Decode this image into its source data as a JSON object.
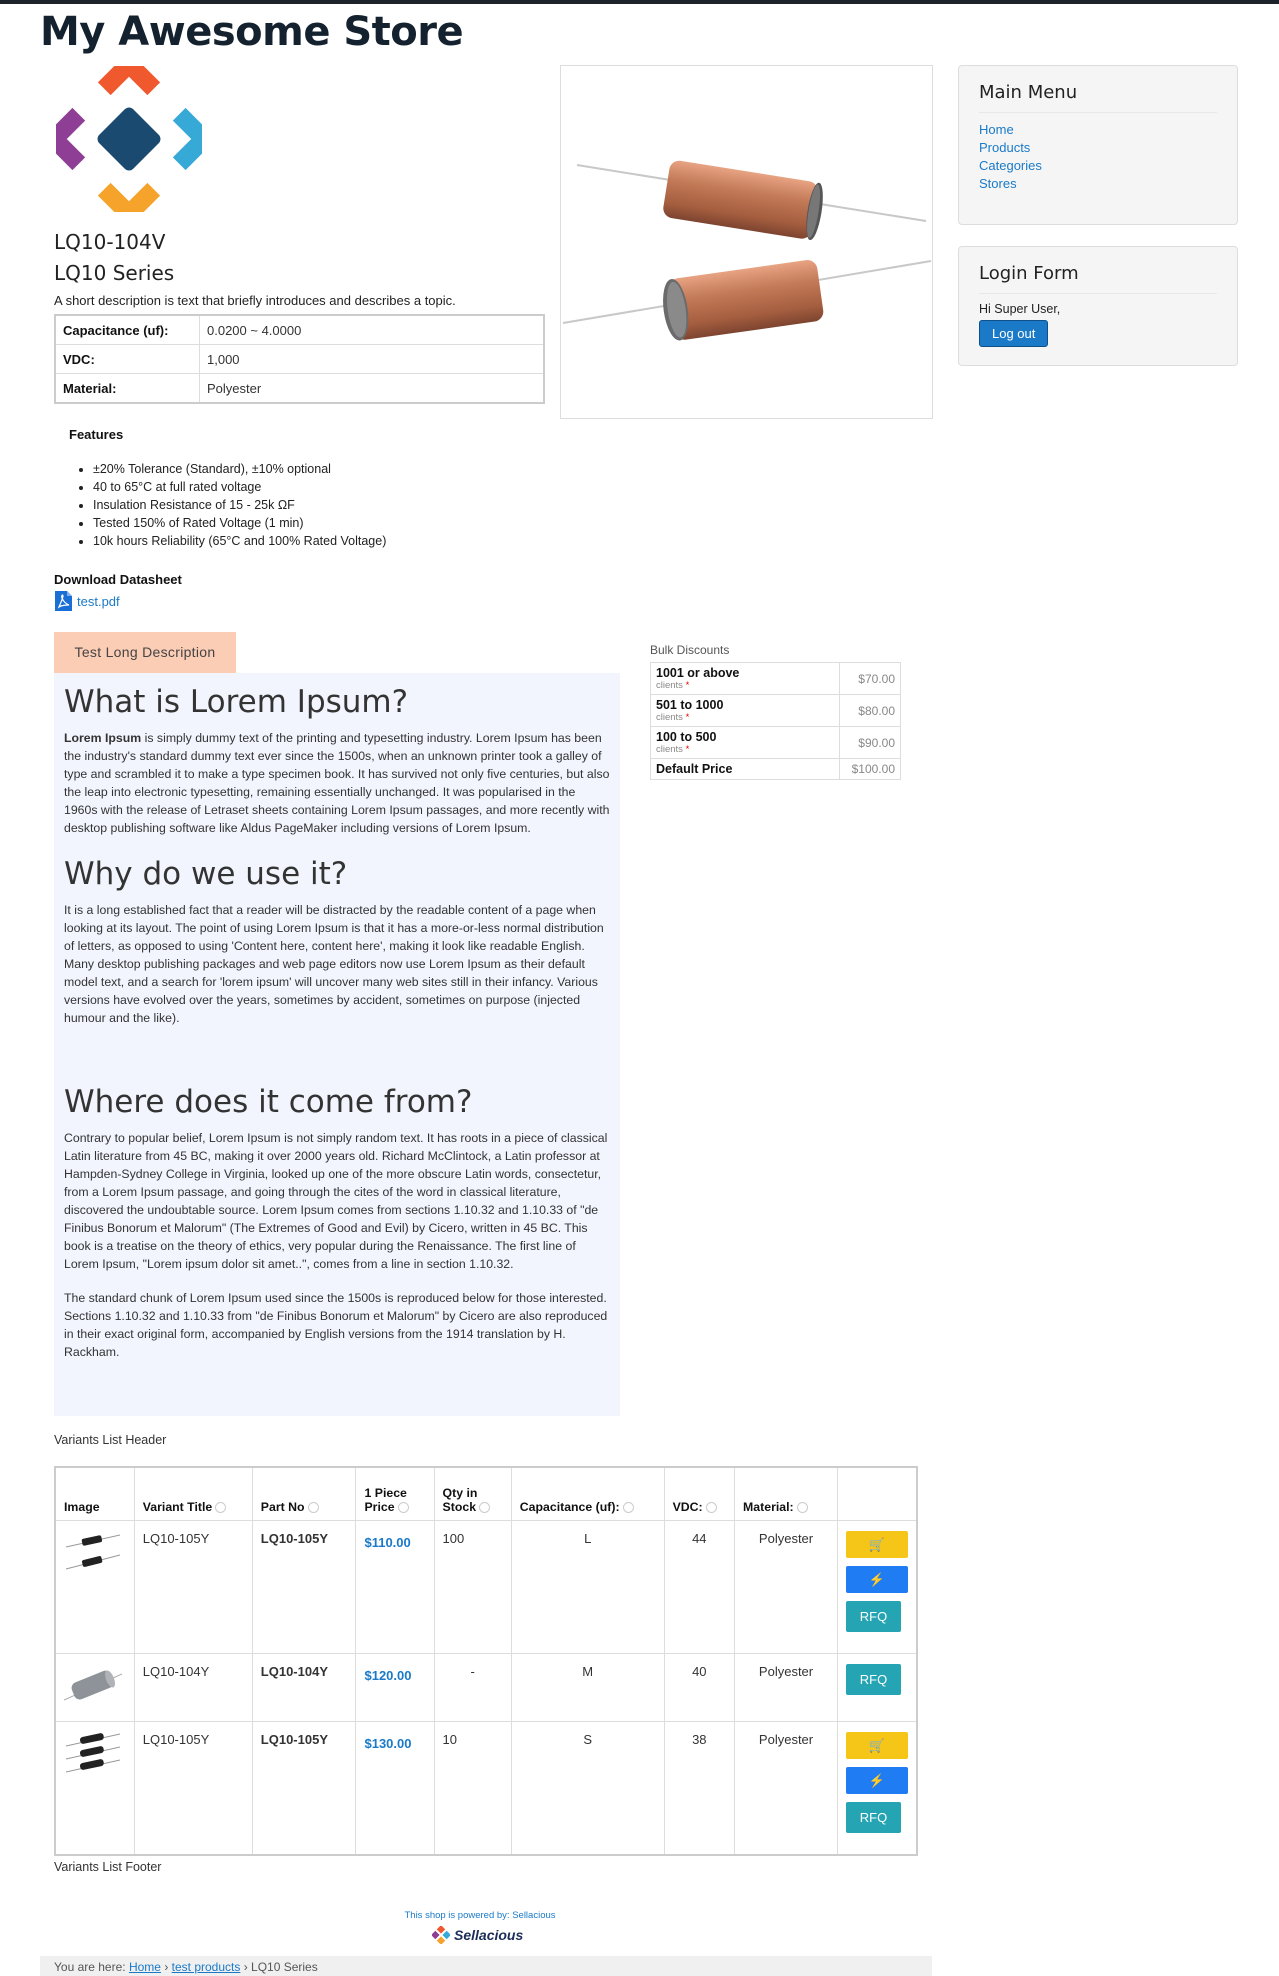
{
  "site": {
    "title": "My Awesome Store"
  },
  "product": {
    "sku": "LQ10-104V",
    "series": "LQ10 Series",
    "short_description": "A short description is text that briefly introduces and describes a topic.",
    "attributes": [
      {
        "label": "Capacitance (uf):",
        "value": "0.0200 ~ 4.0000"
      },
      {
        "label": "VDC:",
        "value": "1,000"
      },
      {
        "label": "Material:",
        "value": "Polyester"
      }
    ],
    "features_title": "Features",
    "features": [
      "±20% Tolerance (Standard), ±10% optional",
      "40 to 65°C at full rated voltage",
      "Insulation Resistance of 15 - 25k ΩF",
      "Tested 150% of Rated Voltage (1 min)",
      "10k hours Reliability (65°C and 100% Rated Voltage)"
    ],
    "datasheet_title": "Download Datasheet",
    "datasheet_file": "test.pdf"
  },
  "sidebar": {
    "main_menu_title": "Main Menu",
    "menu_items": [
      "Home",
      "Products",
      "Categories",
      "Stores"
    ],
    "login_title": "Login Form",
    "greeting": "Hi Super User,",
    "logout_label": "Log out"
  },
  "long_description": {
    "tab_label": "Test Long Description",
    "h1": "What is Lorem Ipsum?",
    "p1_bold": "Lorem Ipsum",
    "p1": " is simply dummy text of the printing and typesetting industry. Lorem Ipsum has been the industry's standard dummy text ever since the 1500s, when an unknown printer took a galley of type and scrambled it to make a type specimen book. It has survived not only five centuries, but also the leap into electronic typesetting, remaining essentially unchanged. It was popularised in the 1960s with the release of Letraset sheets containing Lorem Ipsum passages, and more recently with desktop publishing software like Aldus PageMaker including versions of Lorem Ipsum.",
    "h2": "Why do we use it?",
    "p2": "It is a long established fact that a reader will be distracted by the readable content of a page when looking at its layout. The point of using Lorem Ipsum is that it has a more-or-less normal distribution of letters, as opposed to using 'Content here, content here', making it look like readable English. Many desktop publishing packages and web page editors now use Lorem Ipsum as their default model text, and a search for 'lorem ipsum' will uncover many web sites still in their infancy. Various versions have evolved over the years, sometimes by accident, sometimes on purpose (injected humour and the like).",
    "h3": "Where does it come from?",
    "p3": "Contrary to popular belief, Lorem Ipsum is not simply random text. It has roots in a piece of classical Latin literature from 45 BC, making it over 2000 years old. Richard McClintock, a Latin professor at Hampden-Sydney College in Virginia, looked up one of the more obscure Latin words, consectetur, from a Lorem Ipsum passage, and going through the cites of the word in classical literature, discovered the undoubtable source. Lorem Ipsum comes from sections 1.10.32 and 1.10.33 of \"de Finibus Bonorum et Malorum\" (The Extremes of Good and Evil) by Cicero, written in 45 BC. This book is a treatise on the theory of ethics, very popular during the Renaissance. The first line of Lorem Ipsum, \"Lorem ipsum dolor sit amet..\", comes from a line in section 1.10.32.",
    "p4": "The standard chunk of Lorem Ipsum used since the 1500s is reproduced below for those interested. Sections 1.10.32 and 1.10.33 from \"de Finibus Bonorum et Malorum\" by Cicero are also reproduced in their exact original form, accompanied by English versions from the 1914 translation by H. Rackham."
  },
  "bulk": {
    "title": "Bulk Discounts",
    "tiers": [
      {
        "label": "1001 or above",
        "sub": "clients",
        "price": "$70.00"
      },
      {
        "label": "501 to 1000",
        "sub": "clients",
        "price": "$80.00"
      },
      {
        "label": "100 to 500",
        "sub": "clients",
        "price": "$90.00"
      },
      {
        "label": "Default Price",
        "sub": "",
        "price": "$100.00"
      }
    ]
  },
  "variants": {
    "header_text": "Variants List Header",
    "footer_text": "Variants List Footer",
    "columns": [
      "Image",
      "Variant Title",
      "Part No",
      "1 Piece Price",
      "Qty in Stock",
      "Capacitance (uf):",
      "VDC:",
      "Material:"
    ],
    "rows": [
      {
        "title": "LQ10-105Y",
        "part": "LQ10-105Y",
        "price": "$110.00",
        "qty": "100",
        "cap": "L",
        "vdc": "44",
        "material": "Polyester",
        "rfq": "RFQ"
      },
      {
        "title": "LQ10-104Y",
        "part": "LQ10-104Y",
        "price": "$120.00",
        "qty": "-",
        "cap": "M",
        "vdc": "40",
        "material": "Polyester",
        "rfq": "RFQ"
      },
      {
        "title": "LQ10-105Y",
        "part": "LQ10-105Y",
        "price": "$130.00",
        "qty": "10",
        "cap": "S",
        "vdc": "38",
        "material": "Polyester",
        "rfq": "RFQ"
      }
    ]
  },
  "footer": {
    "powered_by": "This shop is powered by: Sellacious",
    "brand": "Sellacious",
    "breadcrumb_prefix": "You are here:",
    "breadcrumb": [
      "Home",
      "test products",
      "LQ10 Series"
    ]
  },
  "icons": {
    "cart": "shopping-cart-icon",
    "buy": "lightning-bolt-icon",
    "pdf": "pdf-file-icon",
    "sort": "sort-icon"
  },
  "colors": {
    "link": "#1a7ac8",
    "cart_button": "#f5c518",
    "buy_button": "#1f7cf2",
    "rfq_button": "#25a4b3",
    "tab_bg": "#fbcdb5",
    "long_desc_bg": "#f2f5fe"
  }
}
